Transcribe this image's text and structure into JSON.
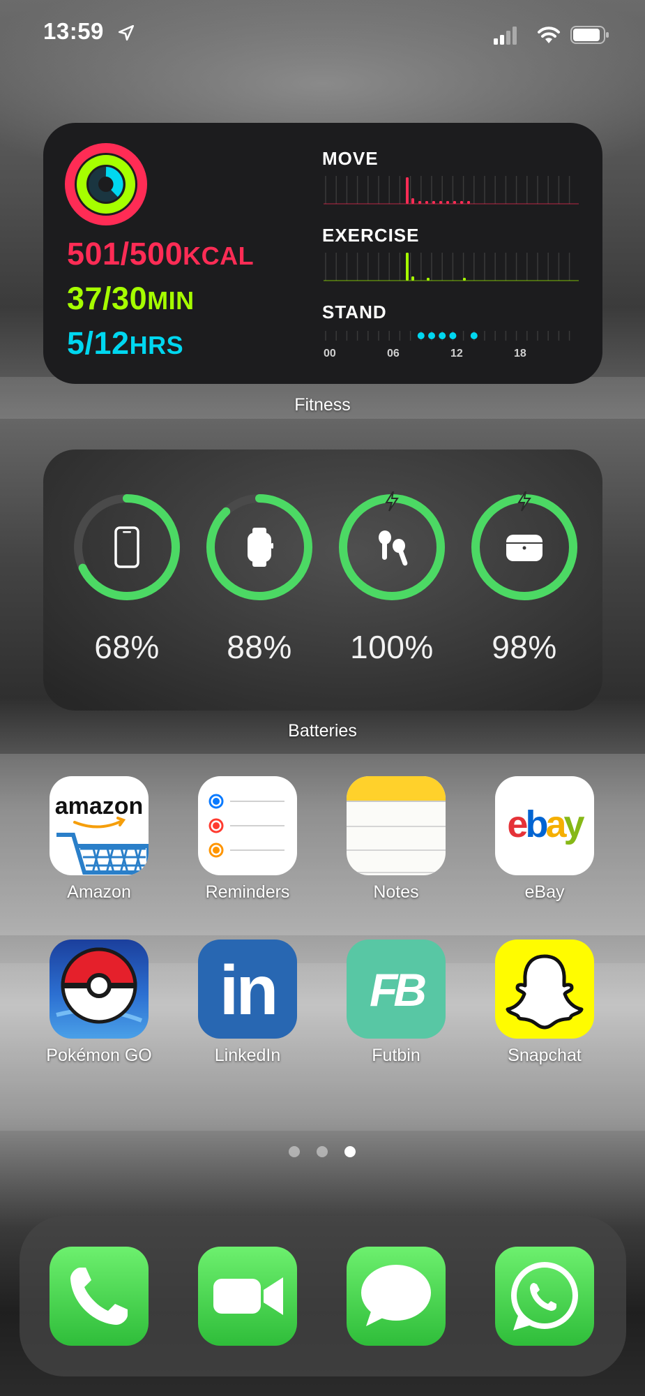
{
  "status_bar": {
    "time": "13:59"
  },
  "fitness": {
    "move_value": "501/500",
    "move_unit": "KCAL",
    "exercise_value": "37/30",
    "exercise_unit": "MIN",
    "stand_value": "5/12",
    "stand_unit": "HRS",
    "move_title": "MOVE",
    "exercise_title": "EXERCISE",
    "stand_title": "STAND",
    "ticks": [
      "00",
      "06",
      "12",
      "18"
    ],
    "label": "Fitness",
    "colors": {
      "move": "#ff2c55",
      "exercise": "#a6ff00",
      "stand": "#00d7f0"
    }
  },
  "batteries": {
    "label": "Batteries",
    "devices": [
      {
        "name": "iphone-icon",
        "percent": "68%",
        "level": 0.68,
        "charging": false
      },
      {
        "name": "watch-icon",
        "percent": "88%",
        "level": 0.88,
        "charging": false
      },
      {
        "name": "airpods-icon",
        "percent": "100%",
        "level": 1.0,
        "charging": true
      },
      {
        "name": "airpods-case-icon",
        "percent": "98%",
        "level": 0.98,
        "charging": true
      }
    ]
  },
  "apps": [
    {
      "label": "Amazon"
    },
    {
      "label": "Reminders"
    },
    {
      "label": "Notes"
    },
    {
      "label": "eBay"
    },
    {
      "label": "Pokémon GO"
    },
    {
      "label": "LinkedIn"
    },
    {
      "label": "Futbin"
    },
    {
      "label": "Snapchat"
    }
  ],
  "app_icon_text": {
    "amazon": "amazon",
    "ebay_e": "e",
    "ebay_b": "b",
    "ebay_a": "a",
    "ebay_y": "y",
    "linkedin": "in",
    "futbin": "FB"
  },
  "pages": {
    "count": 3,
    "current": 3
  },
  "dock": [
    {
      "name": "phone"
    },
    {
      "name": "facetime"
    },
    {
      "name": "messages"
    },
    {
      "name": "whatsapp"
    }
  ]
}
